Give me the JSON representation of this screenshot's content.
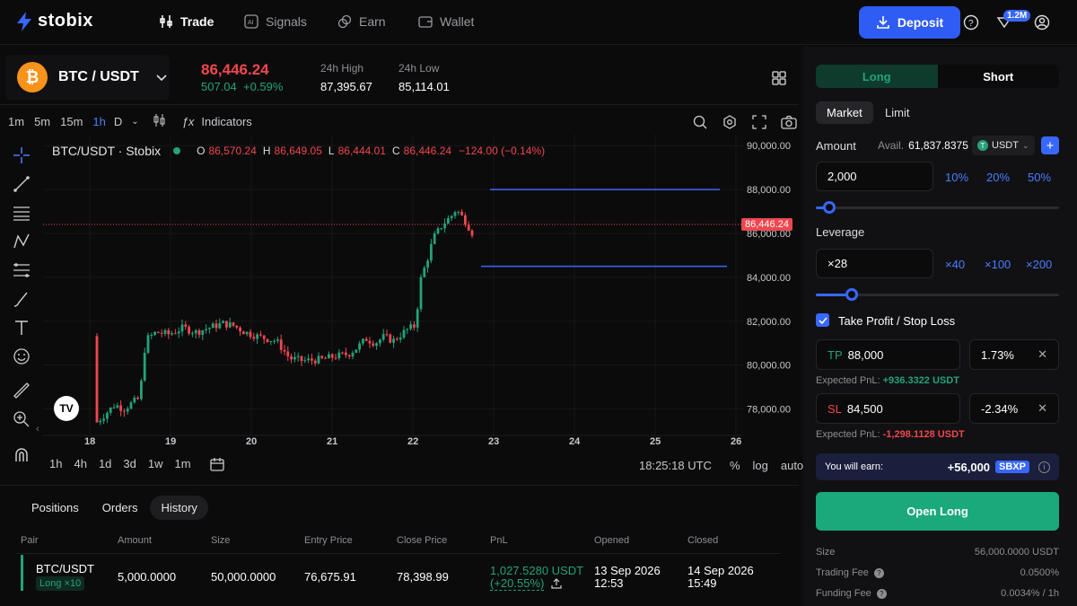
{
  "brand": {
    "name": "stobix"
  },
  "nav": {
    "items": [
      {
        "label": "Trade",
        "icon": "trade-icon"
      },
      {
        "label": "Signals",
        "icon": "ai-icon"
      },
      {
        "label": "Earn",
        "icon": "earn-icon"
      },
      {
        "label": "Wallet",
        "icon": "wallet-icon"
      }
    ],
    "deposit": "Deposit",
    "notif_badge": "1.2M"
  },
  "pair": {
    "name": "BTC / USDT",
    "price": "86,446.24",
    "change": "507.04",
    "change_pct": "+0.59%",
    "high_label": "24h High",
    "high": "87,395.67",
    "low_label": "24h Low",
    "low": "85,114.01"
  },
  "toolbar": {
    "intervals": [
      "1m",
      "5m",
      "15m",
      "1h",
      "D"
    ],
    "active": "1h",
    "indicators": "Indicators"
  },
  "chart": {
    "legend_name": "BTC/USDT · Stobix",
    "o_label": "O",
    "o": "86,570.24",
    "h_label": "H",
    "h": "86,649.05",
    "l_label": "L",
    "l": "86,444.01",
    "c_label": "C",
    "c": "86,446.24",
    "chg": "−124.00 (−0.14%)",
    "y_ticks": [
      "90,000.00",
      "88,000.00",
      "86,000.00",
      "84,000.00",
      "82,000.00",
      "80,000.00",
      "78,000.00"
    ],
    "x_ticks": [
      "18",
      "19",
      "20",
      "21",
      "22",
      "23",
      "24",
      "25",
      "26"
    ],
    "last_price_tag": "86,446.24",
    "ranges": [
      "1h",
      "4h",
      "1d",
      "3d",
      "1w",
      "1m"
    ],
    "time": "18:25:18 UTC",
    "pct": "%",
    "log": "log",
    "auto": "auto"
  },
  "chart_data": {
    "type": "candlestick",
    "ylim": [
      77000,
      90500
    ],
    "take_profit": 88000,
    "stop_loss": 84500,
    "last": 86446.24,
    "y_axis": "price (USDT)",
    "x_axis": "date"
  },
  "orders": {
    "tabs": [
      "Positions",
      "Orders",
      "History"
    ],
    "active": "History",
    "headers": [
      "Pair",
      "Amount",
      "Size",
      "Entry Price",
      "Close Price",
      "PnL",
      "Opened",
      "Closed"
    ],
    "row": {
      "pair": "BTC/USDT",
      "side": "Long ×10",
      "amount": "5,000.0000",
      "size": "50,000.0000",
      "entry": "76,675.91",
      "close": "78,398.99",
      "pnl": "1,027.5280 USDT",
      "pnl_pct": "(+20.55%)",
      "opened_date": "13 Sep 2026",
      "opened_time": "12:53",
      "closed_date": "14 Sep 2026",
      "closed_time": "15:49"
    }
  },
  "panel": {
    "long": "Long",
    "short": "Short",
    "market": "Market",
    "limit": "Limit",
    "amount_label": "Amount",
    "avail_label": "Avail.",
    "avail": "61,837.8375",
    "currency": "USDT",
    "amount": "2,000",
    "amount_pcts": [
      "10%",
      "20%",
      "50%"
    ],
    "leverage_label": "Leverage",
    "leverage": "×28",
    "lev_opts": [
      "×40",
      "×100",
      "×200"
    ],
    "tpsl_label": "Take Profit / Stop Loss",
    "tp_label": "TP",
    "tp": "88,000",
    "tp_pct": "1.73%",
    "tp_pnl_label": "Expected PnL:",
    "tp_pnl": "+936.3322 USDT",
    "sl_label": "SL",
    "sl": "84,500",
    "sl_pct": "-2.34%",
    "sl_pnl_label": "Expected PnL:",
    "sl_pnl": "-1,298.1128 USDT",
    "earn_label": "You will earn:",
    "earn": "+56,000",
    "earn_token": "SBXP",
    "open_long": "Open Long",
    "size_label": "Size",
    "size": "56,000.0000 USDT",
    "fee_label": "Trading Fee",
    "fee": "0.0500%",
    "funding_label": "Funding Fee",
    "funding": "0.0034% / 1h"
  },
  "colors": {
    "green": "#22a37a",
    "red": "#f0474f",
    "blue": "#3867ff",
    "brand": "#2f5cf5"
  }
}
